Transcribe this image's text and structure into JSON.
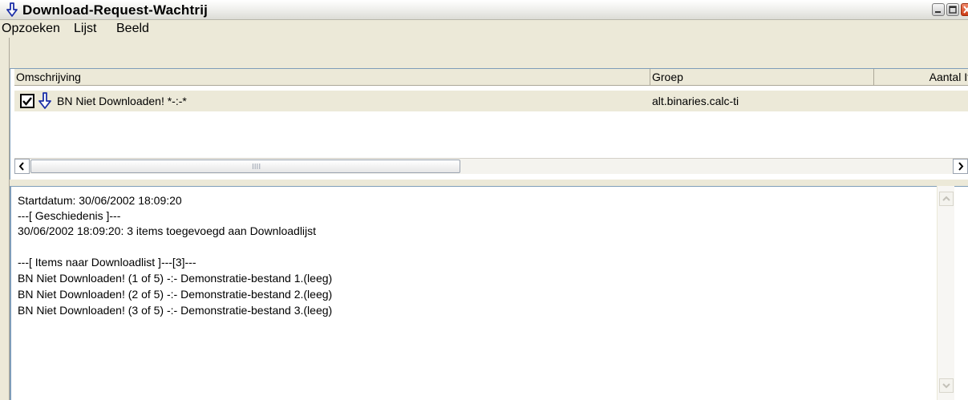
{
  "window": {
    "title": "Download-Request-Wachtrij"
  },
  "menubar": {
    "items": [
      "Opzoeken",
      "Lijst",
      "Beeld"
    ]
  },
  "list": {
    "columns": [
      "Omschrijving",
      "Groep",
      "Aantal It"
    ],
    "rows": [
      {
        "checked": true,
        "description": "BN Niet Downloaden! *-:-*",
        "group": "alt.binaries.calc-ti"
      }
    ]
  },
  "hscroll": {
    "grip": "IIII"
  },
  "log": {
    "lines": [
      "Startdatum: 30/06/2002 18:09:20",
      "---[ Geschiedenis ]---",
      "30/06/2002 18:09:20: 3 items toegevoegd aan Downloadlijst",
      "",
      "---[ Items naar Downloadlist ]---[3]---",
      "BN Niet Downloaden! (1 of 5) -:- Demonstratie-bestand 1.(leeg)",
      "BN Niet Downloaden! (2 of 5) -:- Demonstratie-bestand 2.(leeg)",
      "BN Niet Downloaden! (3 of 5) -:- Demonstratie-bestand 3.(leeg)"
    ]
  },
  "colors": {
    "arrow_icon": "#1c2fa8",
    "close_button": "#d84a22",
    "selection_row": "#ece9d8"
  },
  "icons": {
    "title": "download-arrow-icon",
    "row": "download-arrow-icon"
  }
}
